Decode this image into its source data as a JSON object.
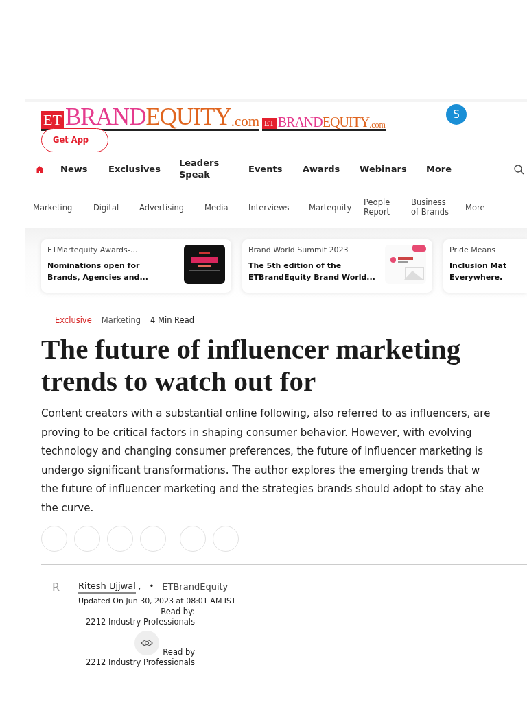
{
  "header": {
    "logos": [
      {
        "et": "ET",
        "brand": "BRAND",
        "equity": "EQUITY",
        "com": ".com"
      },
      {
        "et": "ET",
        "brand": "BRAND",
        "equity": "EQUITY",
        "com": ".com"
      }
    ],
    "get_app": "Get App",
    "avatar": "S"
  },
  "nav": [
    {
      "kind": "home",
      "selected": true
    },
    {
      "kind": "link",
      "label": "News",
      "selected": false
    },
    {
      "kind": "link",
      "label": "Exclusives",
      "selected": false
    },
    {
      "kind": "link",
      "label": "Leaders Speak",
      "selected": false
    },
    {
      "kind": "link",
      "label": "Events",
      "selected": false
    },
    {
      "kind": "link",
      "label": "Awards",
      "selected": false
    },
    {
      "kind": "link",
      "label": "Webinars",
      "selected": false
    },
    {
      "kind": "link",
      "label": "More",
      "selected": false
    },
    {
      "kind": "search"
    }
  ],
  "sub_nav": [
    "Marketing",
    "Digital",
    "Advertising",
    "Media",
    "Interviews",
    "Martequity",
    "People Report",
    "Business of Brands",
    "More"
  ],
  "cards": [
    {
      "kind": "dark_image",
      "category": "ETMartequity Awards-...",
      "title": [
        "Nominations open for",
        "Brands, Agencies and..."
      ]
    },
    {
      "kind": "light_image",
      "category": "Brand World Summit 2023",
      "title": [
        "The 5th edition of the",
        "ETBrandEquity Brand World..."
      ]
    },
    {
      "kind": "text",
      "category": "Pride Means",
      "title": [
        "Inclusion Mat",
        "Everywhere."
      ]
    }
  ],
  "tags": [
    {
      "kind": "highlight",
      "label": "Exclusive"
    },
    {
      "kind": "category",
      "label": "Marketing"
    },
    {
      "kind": "read_time",
      "label": "4 Min Read"
    }
  ],
  "headline": [
    "The future of influencer marketing",
    "trends to watch out for"
  ],
  "summary": [
    "Content creators with a substantial online following, also referred to as influencers, are",
    "proving to be critical factors in shaping consumer behavior. However, with evolving",
    "technology and changing consumer preferences, the future of influencer marketing is",
    "undergo significant transformations. The author explores the emerging trends that w",
    "the future of influencer marketing and the strategies brands should adopt to stay ahe",
    "the curve."
  ],
  "share_buttons": [
    {
      "kind": "share"
    },
    {
      "kind": "share"
    },
    {
      "kind": "share"
    },
    {
      "kind": "share"
    },
    {
      "kind": "share"
    },
    {
      "kind": "share"
    }
  ],
  "byline": {
    "avatar": "R",
    "author": "Ritesh Ujjwal",
    "separator": ",",
    "bullet": "•",
    "source": "ETBrandEquity",
    "updated": "Updated On Jun 30, 2023 at 08:01 AM IST",
    "read_by": [
      {
        "label": "Read by:",
        "count": "2212 Industry Professionals"
      },
      {
        "kind": "eye",
        "label": "Read by",
        "count": "2212 Industry Professionals"
      }
    ]
  }
}
